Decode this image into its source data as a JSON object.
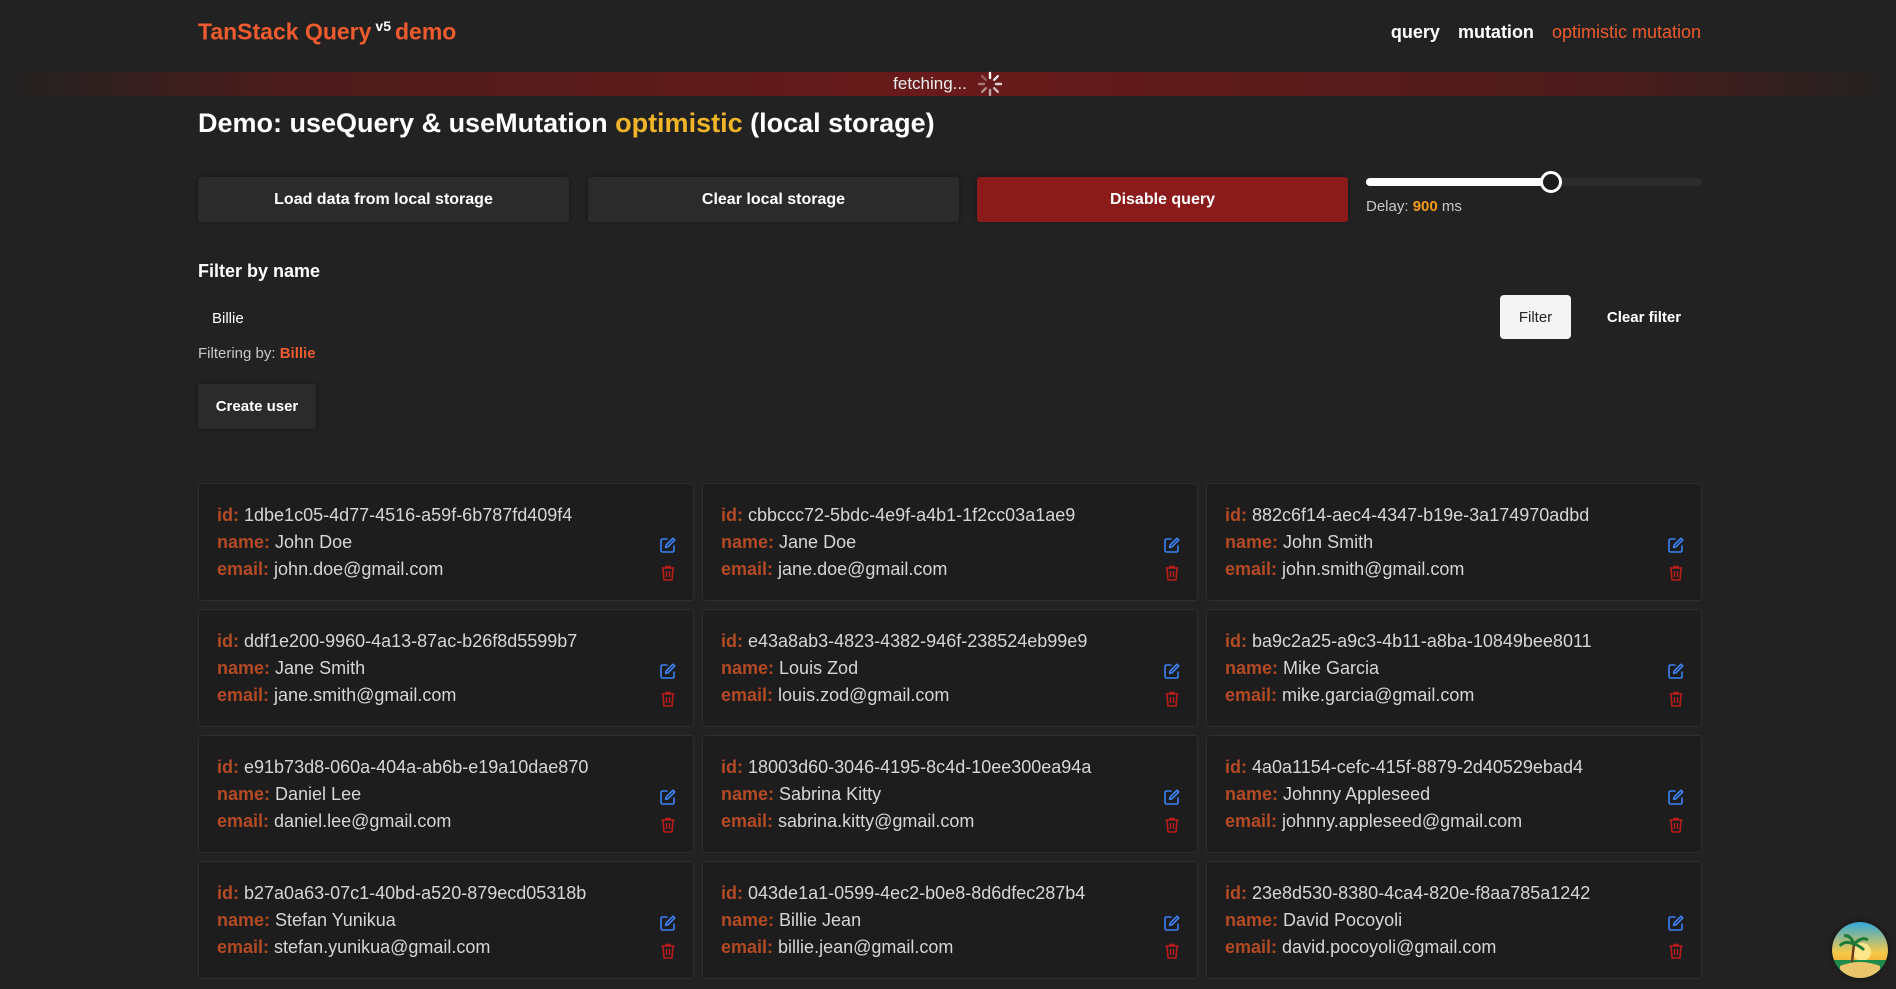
{
  "brand": {
    "name": "TanStack Query",
    "version": "v5",
    "suffix": "demo"
  },
  "nav": [
    {
      "label": "query",
      "active": false
    },
    {
      "label": "mutation",
      "active": false
    },
    {
      "label": "optimistic mutation",
      "active": true
    }
  ],
  "status": {
    "fetching_label": "fetching..."
  },
  "heading": {
    "prefix": "Demo: useQuery & useMutation",
    "highlight": "optimistic",
    "suffix": "(local storage)"
  },
  "actions": {
    "load": "Load data from local storage",
    "clear": "Clear local storage",
    "disable": "Disable query"
  },
  "delay": {
    "label": "Delay:",
    "value": "900",
    "unit": "ms",
    "fraction": 0.55
  },
  "filter": {
    "label": "Filter by name",
    "value": "Billie",
    "filter_button": "Filter",
    "clear_button": "Clear filter",
    "status_label": "Filtering by:",
    "status_value": "Billie"
  },
  "create_button": "Create user",
  "field_labels": {
    "id": "id:",
    "name": "name:",
    "email": "email:"
  },
  "users": [
    {
      "id": "1dbe1c05-4d77-4516-a59f-6b787fd409f4",
      "name": "John Doe",
      "email": "john.doe@gmail.com"
    },
    {
      "id": "cbbccc72-5bdc-4e9f-a4b1-1f2cc03a1ae9",
      "name": "Jane Doe",
      "email": "jane.doe@gmail.com"
    },
    {
      "id": "882c6f14-aec4-4347-b19e-3a174970adbd",
      "name": "John Smith",
      "email": "john.smith@gmail.com"
    },
    {
      "id": "ddf1e200-9960-4a13-87ac-b26f8d5599b7",
      "name": "Jane Smith",
      "email": "jane.smith@gmail.com"
    },
    {
      "id": "e43a8ab3-4823-4382-946f-238524eb99e9",
      "name": "Louis Zod",
      "email": "louis.zod@gmail.com"
    },
    {
      "id": "ba9c2a25-a9c3-4b11-a8ba-10849bee8011",
      "name": "Mike Garcia",
      "email": "mike.garcia@gmail.com"
    },
    {
      "id": "e91b73d8-060a-404a-ab6b-e19a10dae870",
      "name": "Daniel Lee",
      "email": "daniel.lee@gmail.com"
    },
    {
      "id": "18003d60-3046-4195-8c4d-10ee300ea94a",
      "name": "Sabrina Kitty",
      "email": "sabrina.kitty@gmail.com"
    },
    {
      "id": "4a0a1154-cefc-415f-8879-2d40529ebad4",
      "name": "Johnny Appleseed",
      "email": "johnny.appleseed@gmail.com"
    },
    {
      "id": "b27a0a63-07c1-40bd-a520-879ecd05318b",
      "name": "Stefan Yunikua",
      "email": "stefan.yunikua@gmail.com"
    },
    {
      "id": "043de1a1-0599-4ec2-b0e8-8d6dfec287b4",
      "name": "Billie Jean",
      "email": "billie.jean@gmail.com"
    },
    {
      "id": "23e8d530-8380-4ca4-820e-f8aa785a1242",
      "name": "David Pocoyoli",
      "email": "david.pocoyoli@gmail.com"
    }
  ],
  "icons": {
    "edit": "edit-icon",
    "delete": "trash-icon",
    "loading": "spinner-icon",
    "devtools": "tanstack-logo"
  },
  "colors": {
    "accent": "#ee5b2e",
    "highlight": "#f0b429",
    "danger": "#8b1a1a",
    "label": "#b24a25",
    "edit_icon": "#3b82f6",
    "delete_icon": "#b91c1c"
  }
}
